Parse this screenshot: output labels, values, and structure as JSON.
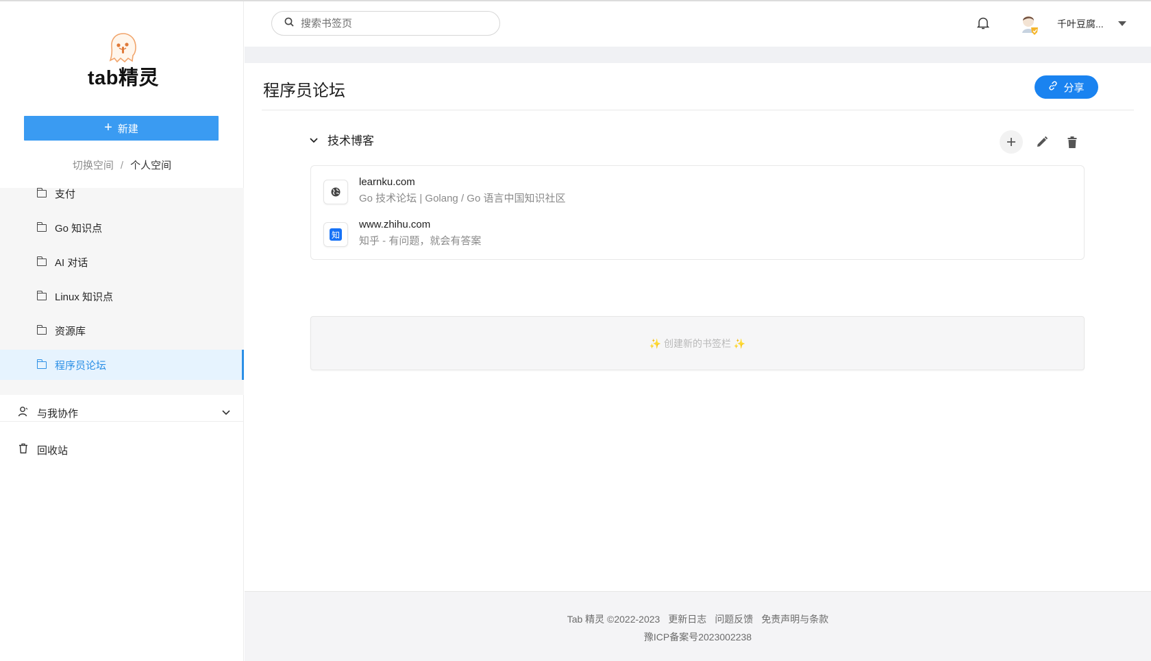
{
  "app": {
    "name": "tab精灵"
  },
  "sidebar": {
    "new_label": "新建",
    "switch_space": "切换空间",
    "separator": "/",
    "current_space": "个人空间",
    "folders": [
      {
        "label": "支付"
      },
      {
        "label": "Go 知识点"
      },
      {
        "label": "AI 对话"
      },
      {
        "label": "Linux 知识点"
      },
      {
        "label": "资源库"
      },
      {
        "label": "程序员论坛",
        "active": true
      }
    ],
    "collab_label": "与我协作",
    "trash_label": "回收站"
  },
  "header": {
    "search_placeholder": "搜索书签页",
    "username": "千叶豆腐..."
  },
  "main": {
    "title": "程序员论坛",
    "share_label": "分享",
    "group": {
      "title": "技术博客",
      "bookmarks": [
        {
          "domain": "learnku.com",
          "desc": "Go 技术论坛 | Golang / Go 语言中国知识社区",
          "icon": "globe-icon"
        },
        {
          "domain": "www.zhihu.com",
          "desc": "知乎 - 有问题，就会有答案",
          "icon": "zhihu-icon",
          "icon_text": "知"
        }
      ]
    },
    "create_bar_label": "✨ 创建新的书签栏 ✨"
  },
  "footer": {
    "copyright": "Tab 精灵 ©2022-2023",
    "changelog": "更新日志",
    "feedback": "问题反馈",
    "terms": "免责声明与条款",
    "icp": "豫ICP备案号2023002238"
  },
  "colors": {
    "primary": "#3a9bf2",
    "share": "#1a83f0",
    "active_bg": "#e6f3fe"
  }
}
